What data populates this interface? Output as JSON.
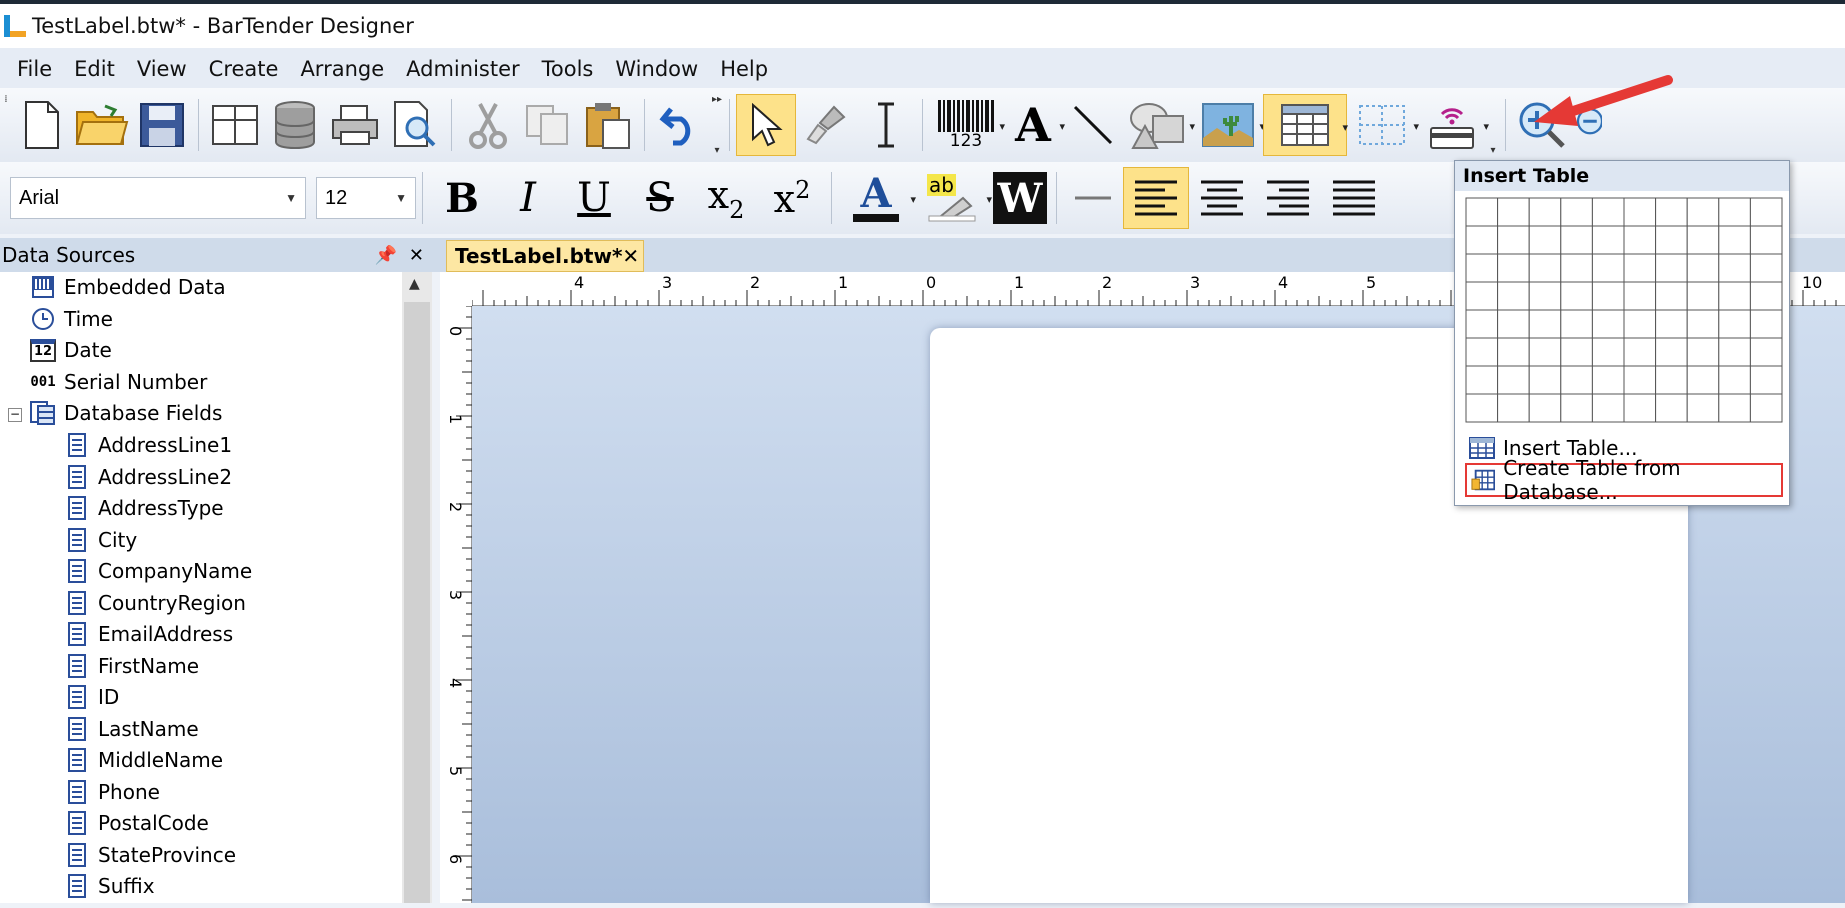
{
  "window": {
    "title": "TestLabel.btw* - BarTender Designer"
  },
  "menu": [
    "File",
    "Edit",
    "View",
    "Create",
    "Arrange",
    "Administer",
    "Tools",
    "Window",
    "Help"
  ],
  "format_toolbar": {
    "font": "Arial",
    "size": "12",
    "bold": "B",
    "italic": "I",
    "underline": "U",
    "strike": "S",
    "subscript_base": "x",
    "subscript_mark": "2",
    "superscript_base": "x",
    "superscript_mark": "2",
    "font_color_letter": "A",
    "highlight_letter": "ab",
    "wordart_letter": "W"
  },
  "main_toolbar": {
    "barcode_digits": "123",
    "text_letter": "A"
  },
  "data_sources": {
    "title": "Data Sources",
    "pin": "ၐ",
    "close": "✕",
    "items": [
      {
        "label": "Embedded Data",
        "icon": "embedded-data-icon"
      },
      {
        "label": "Time",
        "icon": "clock-icon"
      },
      {
        "label": "Date",
        "icon": "calendar-icon",
        "icon_text": "12"
      },
      {
        "label": "Serial Number",
        "icon": "serial-number-icon",
        "icon_text": "001"
      },
      {
        "label": "Database Fields",
        "icon": "database-fields-icon"
      }
    ],
    "fields": [
      "AddressLine1",
      "AddressLine2",
      "AddressType",
      "City",
      "CompanyName",
      "CountryRegion",
      "EmailAddress",
      "FirstName",
      "ID",
      "LastName",
      "MiddleName",
      "Phone",
      "PostalCode",
      "StateProvince",
      "Suffix"
    ]
  },
  "document": {
    "tab_label": "TestLabel.btw*",
    "tab_close": "✕"
  },
  "ruler": {
    "horizontal_labels": [
      "4",
      "3",
      "2",
      "1",
      "0",
      "1",
      "2",
      "3",
      "4",
      "5",
      "10"
    ],
    "vertical_labels": [
      "0",
      "1",
      "2",
      "3",
      "4",
      "5",
      "6"
    ]
  },
  "insert_table_dropdown": {
    "title": "Insert Table",
    "grid_columns": 10,
    "grid_rows": 8,
    "items": [
      "Insert Table...",
      "Create Table from Database..."
    ]
  },
  "colors": {
    "highlight": "#fde28a",
    "annotation_red": "#e53935"
  }
}
